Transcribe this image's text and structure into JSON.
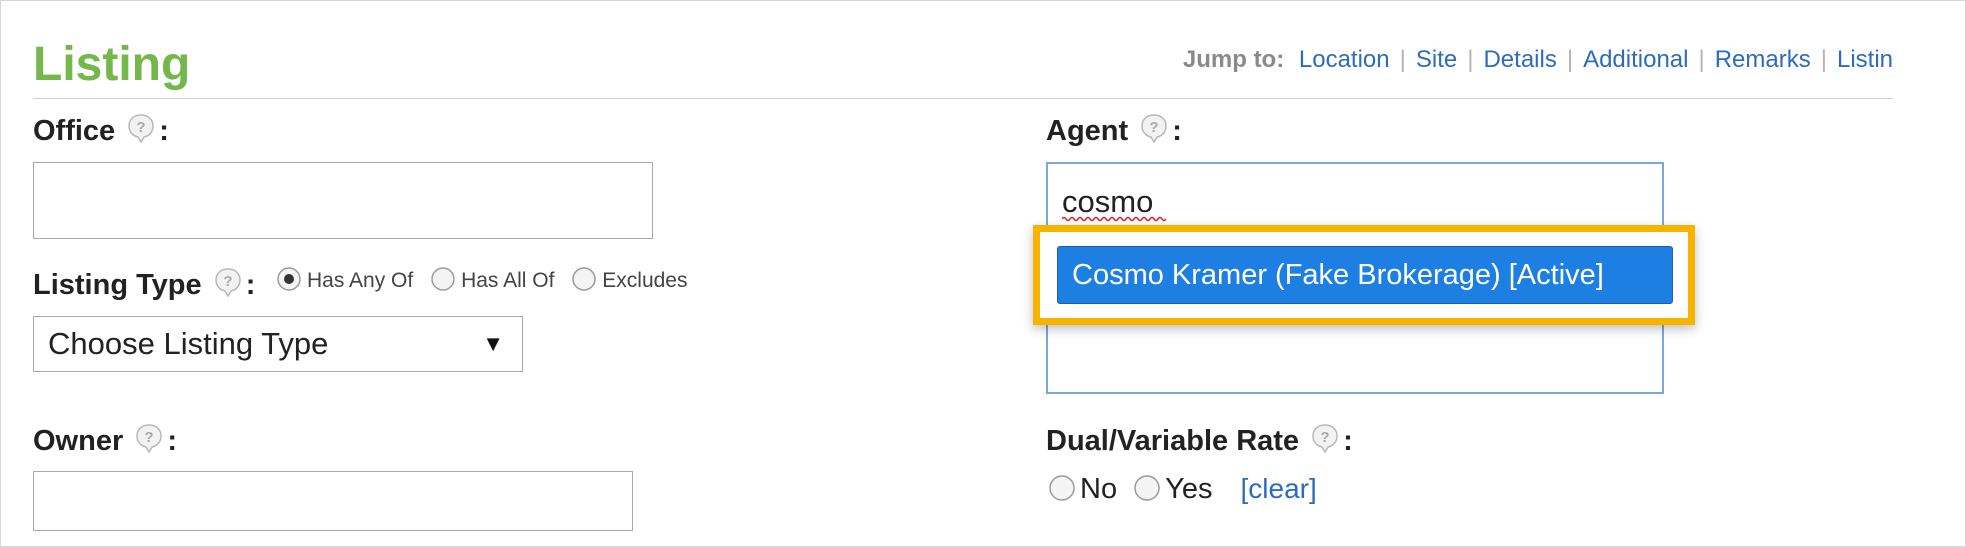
{
  "section": {
    "title": "Listing"
  },
  "jump": {
    "label": "Jump to:",
    "links": [
      "Location",
      "Site",
      "Details",
      "Additional",
      "Remarks",
      "Listin"
    ]
  },
  "fields": {
    "office": {
      "label": "Office",
      "colon": ":",
      "value": ""
    },
    "listing_type": {
      "label": "Listing Type",
      "colon": ":",
      "match_options": [
        "Has Any Of",
        "Has All Of",
        "Excludes"
      ],
      "match_selected": "Has Any Of",
      "select_value": "Choose Listing Type",
      "arrow": "▼"
    },
    "owner": {
      "label": "Owner",
      "colon": ":",
      "value": ""
    },
    "agent": {
      "label": "Agent",
      "colon": ":",
      "value": "cosmo",
      "suggestion": "Cosmo Kramer (Fake Brokerage) [Active]"
    },
    "dual_rate": {
      "label": "Dual/Variable Rate",
      "colon": ":",
      "options": [
        "No",
        "Yes"
      ],
      "clear_label": "[clear]"
    }
  },
  "icons": {
    "help": "help-question-icon",
    "radio": "radio-button-icon"
  },
  "colors": {
    "title_green": "#74b74a",
    "link_blue": "#2d6bbf",
    "highlight_orange": "#f6b300",
    "suggestion_blue": "#1e7fe3"
  }
}
